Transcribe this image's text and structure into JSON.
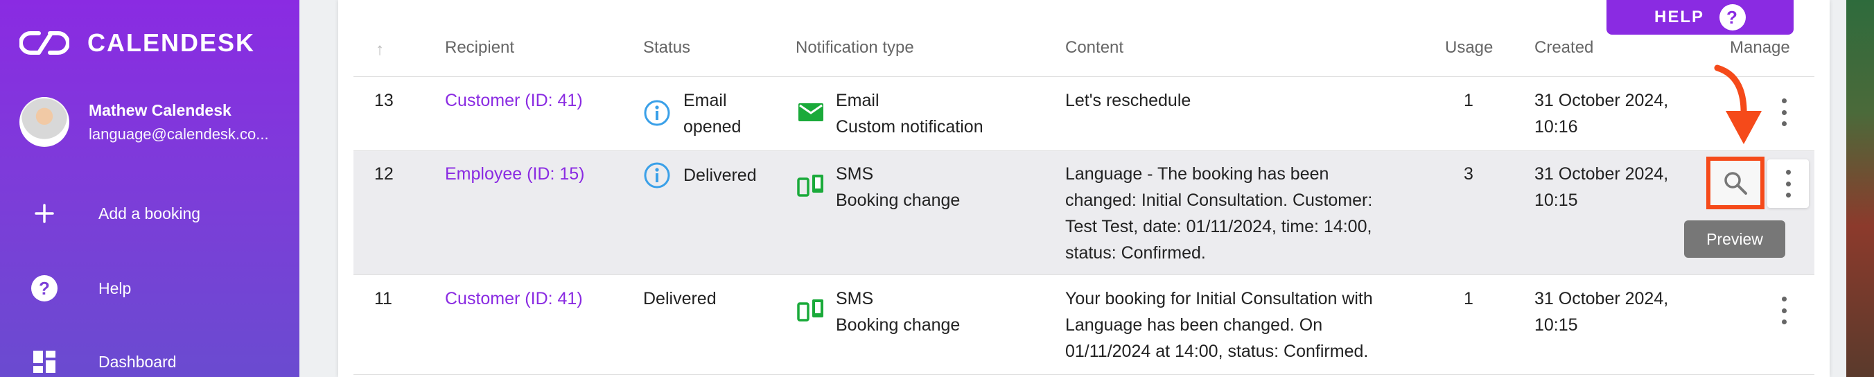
{
  "sidebar": {
    "brand": "CALENDESK",
    "user": {
      "name": "Mathew Calendesk",
      "email": "language@calendesk.co..."
    },
    "items": [
      {
        "label": "Add a booking",
        "icon": "plus-icon"
      },
      {
        "label": "Help",
        "icon": "help-circle-icon"
      },
      {
        "label": "Dashboard",
        "icon": "dashboard-icon"
      }
    ]
  },
  "help_button": {
    "label": "HELP",
    "icon": "question-icon"
  },
  "table": {
    "headers": {
      "recipient": "Recipient",
      "status": "Status",
      "notification_type": "Notification type",
      "content": "Content",
      "usage": "Usage",
      "created": "Created",
      "manage": "Manage"
    },
    "rows": [
      {
        "id": "13",
        "recipient": "Customer (ID: 41)",
        "status_lines": [
          "Email",
          "opened"
        ],
        "type_icon": "email-icon",
        "type_lines": [
          "Email",
          "Custom notification"
        ],
        "content_lines": [
          "Let's reschedule"
        ],
        "usage": "1",
        "created_lines": [
          "31 October 2024,",
          "10:16"
        ]
      },
      {
        "id": "12",
        "recipient": "Employee (ID: 15)",
        "status_lines": [
          "Delivered"
        ],
        "type_icon": "sms-icon",
        "type_lines": [
          "SMS",
          "Booking change"
        ],
        "content_lines": [
          "Language - The booking has been",
          "changed: Initial Consultation. Customer:",
          "Test Test, date: 01/11/2024, time: 14:00,",
          "status: Confirmed."
        ],
        "usage": "3",
        "created_lines": [
          "31 October 2024,",
          "10:15"
        ]
      },
      {
        "id": "11",
        "recipient": "Customer (ID: 41)",
        "status_lines": [
          "Delivered"
        ],
        "type_icon": "sms-icon",
        "type_lines": [
          "SMS",
          "Booking change"
        ],
        "content_lines": [
          "Your booking for Initial Consultation with",
          "Language has been changed. On",
          "01/11/2024 at 14:00, status: Confirmed."
        ],
        "usage": "1",
        "created_lines": [
          "31 October 2024,",
          "10:15"
        ]
      }
    ]
  },
  "tooltip": {
    "label": "Preview"
  },
  "colors": {
    "accent": "#8a2be2",
    "highlight": "#f54a1a",
    "info": "#3aa0e8",
    "type_green": "#1aaa3a"
  }
}
